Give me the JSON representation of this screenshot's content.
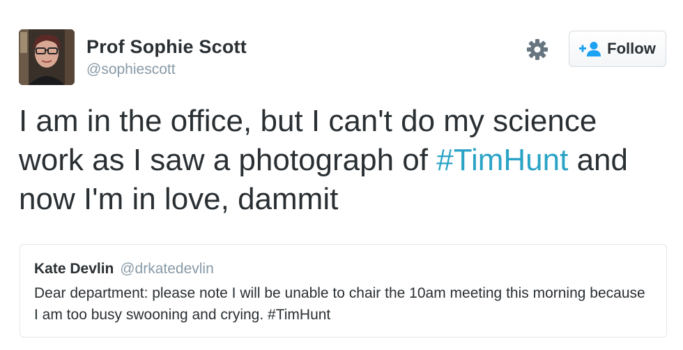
{
  "author": {
    "name": "Prof Sophie Scott",
    "handle": "@sophiescott"
  },
  "actions": {
    "settings_icon": "gear-icon",
    "follow_icon": "add-user-icon",
    "follow_label": "Follow"
  },
  "tweet": {
    "text_before": "I am in the office, but I can't do my science work as I saw a photograph of",
    "hashtag": "#TimHunt",
    "text_after": "and now I'm in love, dammit"
  },
  "quoted_tweet": {
    "name": "Kate Devlin",
    "handle": "@drkatedevlin",
    "text": "Dear department: please note I will be unable to chair the 10am meeting this morning because I am too busy swooning and crying. #TimHunt"
  },
  "colors": {
    "hashtag": "#2aa3c6",
    "muted": "#8899a6",
    "text": "#292f33"
  }
}
